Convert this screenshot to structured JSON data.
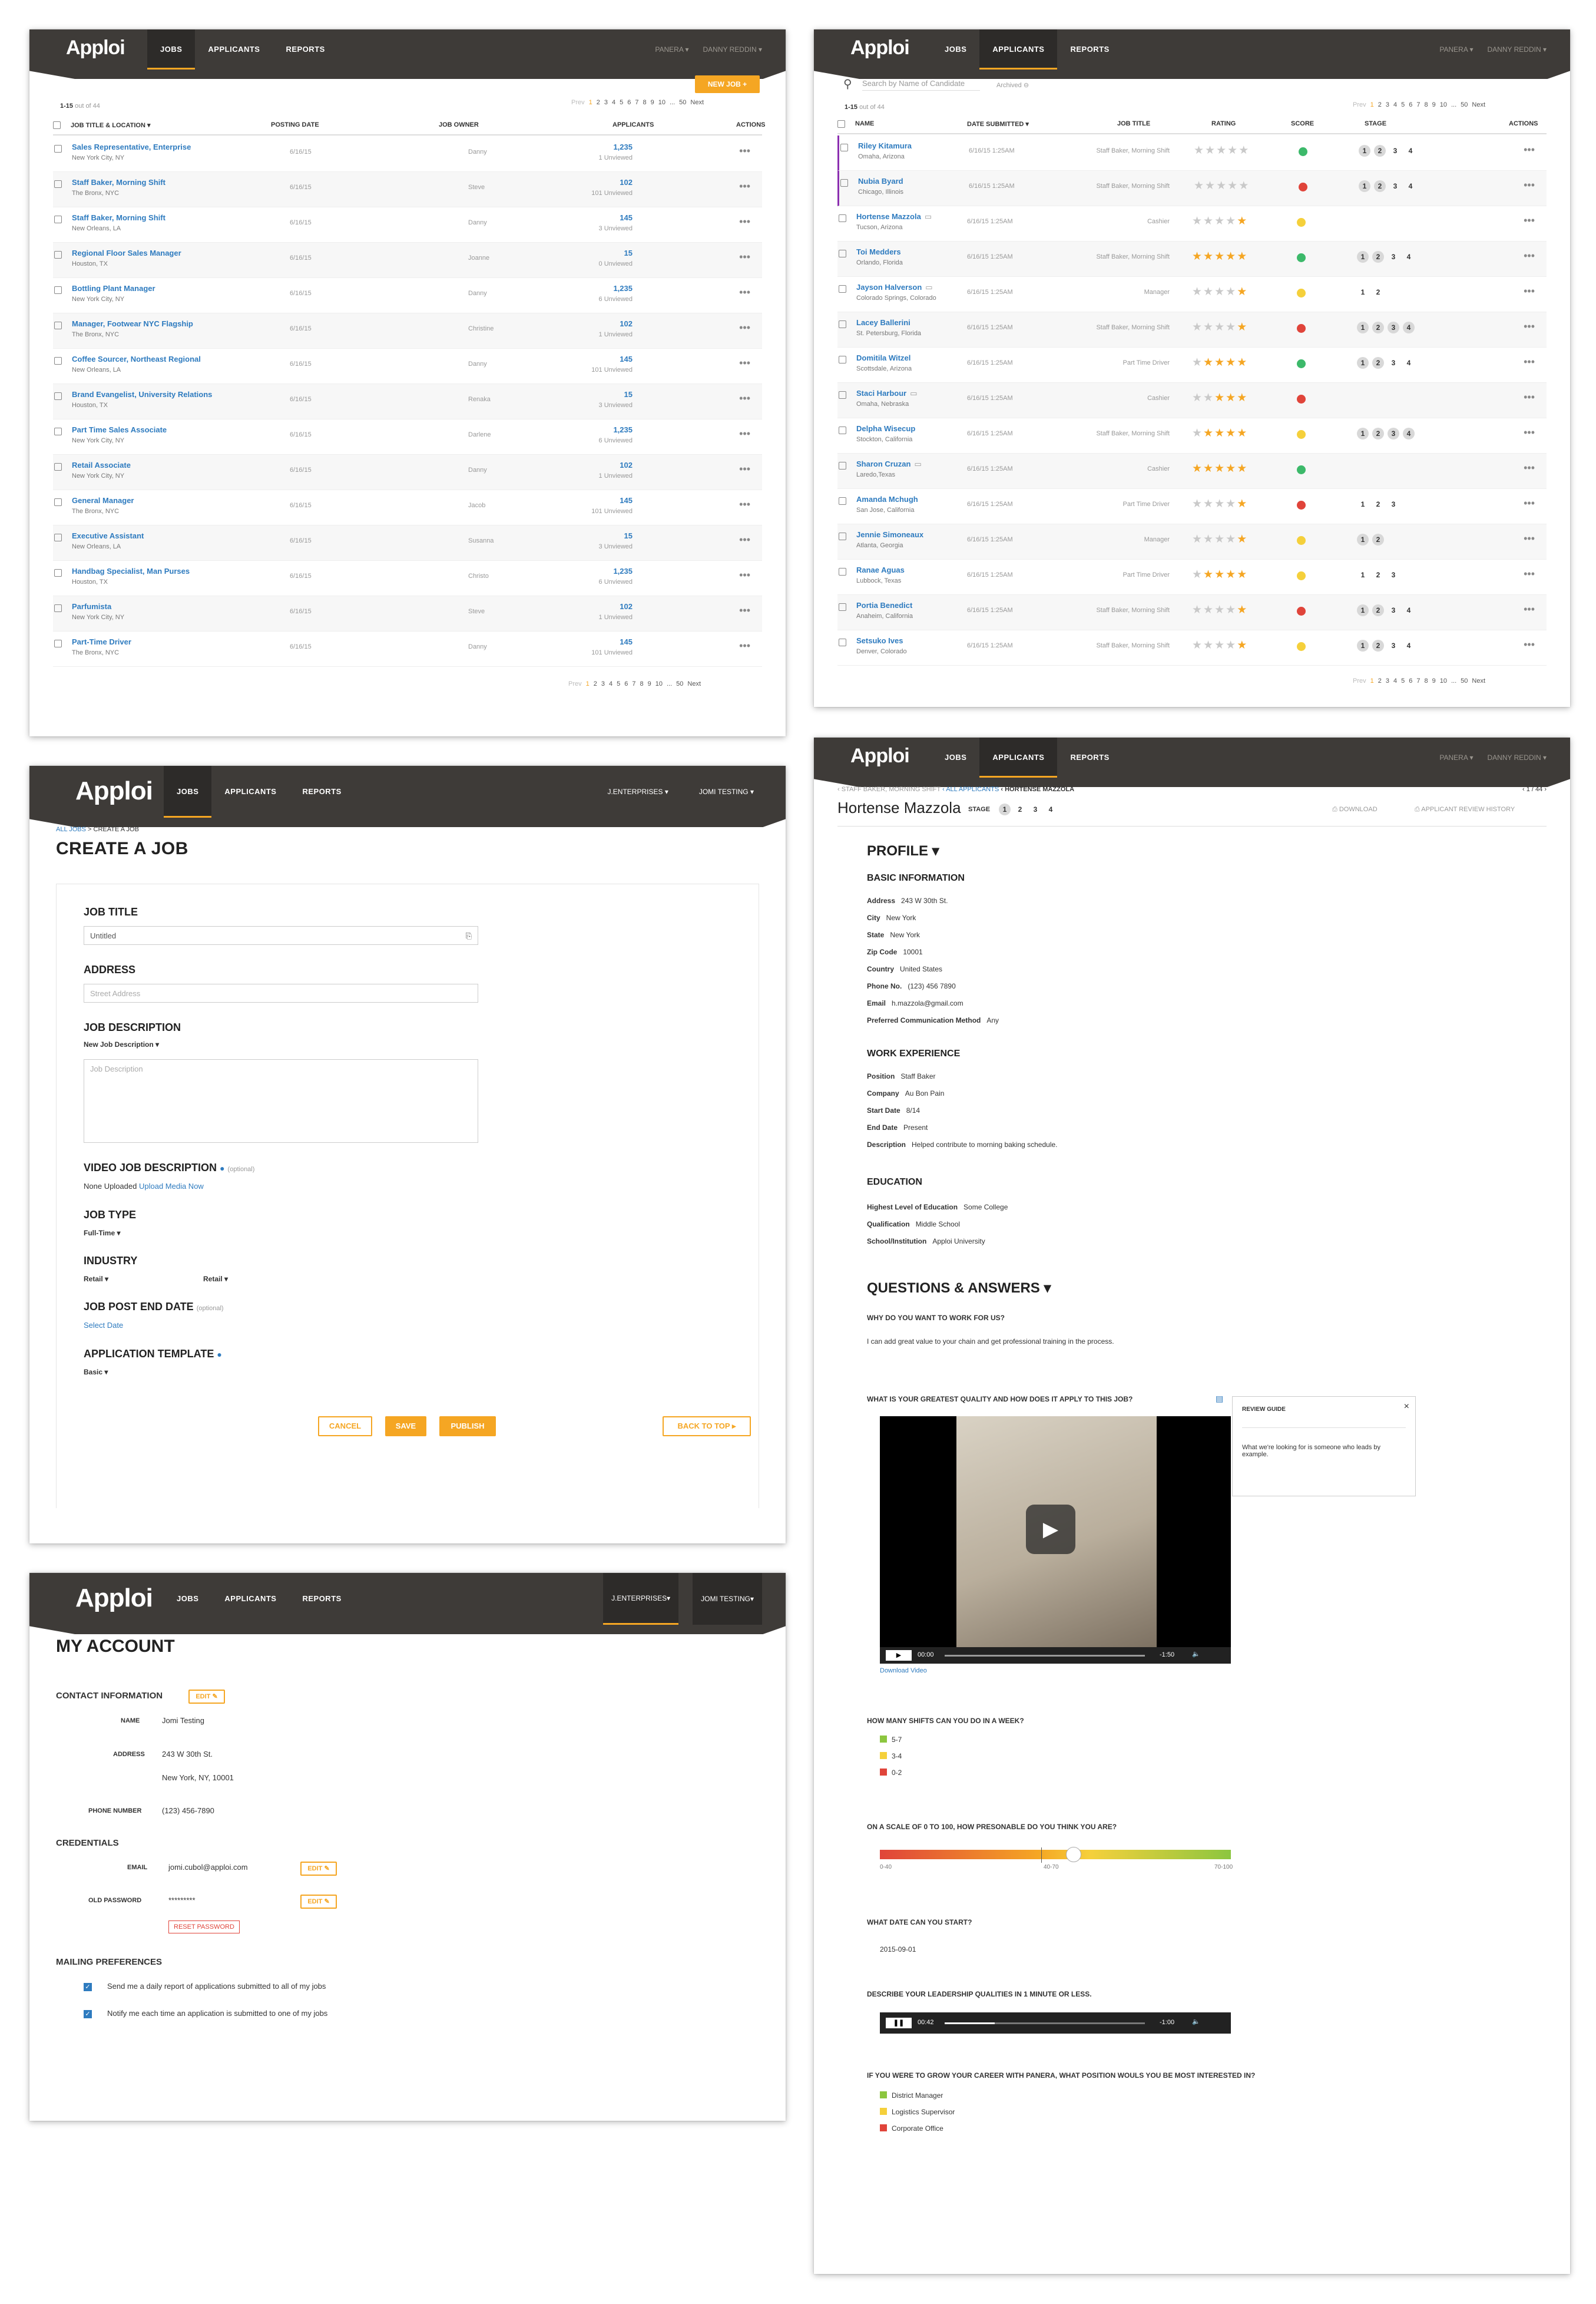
{
  "app": {
    "logo": "Apploi",
    "nav_jobs": "JOBS",
    "nav_applicants": "APPLICANTS",
    "nav_reports": "REPORTS",
    "user_company": "PANERA",
    "user_name": "DANNY REDDIN"
  },
  "jobs": {
    "new_job": "NEW JOB +",
    "range": "1-15",
    "out_of": "out of 44",
    "pagination": [
      "Prev",
      "1",
      "2",
      "3",
      "4",
      "5",
      "6",
      "7",
      "8",
      "9",
      "10",
      "...",
      "50",
      "Next"
    ],
    "columns": [
      "JOB TITLE & LOCATION",
      "POSTING DATE",
      "JOB OWNER",
      "APPLICANTS",
      "ACTIONS"
    ],
    "rows": [
      {
        "title": "Sales Representative, Enterprise",
        "loc": "New York City, NY",
        "date": "6/16/15",
        "owner": "Danny",
        "count": "1,235",
        "unviewed": "1 Unviewed"
      },
      {
        "title": "Staff Baker, Morning Shift",
        "loc": "The Bronx, NYC",
        "date": "6/16/15",
        "owner": "Steve",
        "count": "102",
        "unviewed": "101 Unviewed"
      },
      {
        "title": "Staff Baker, Morning Shift",
        "loc": "New Orleans, LA",
        "date": "6/16/15",
        "owner": "Danny",
        "count": "145",
        "unviewed": "3 Unviewed"
      },
      {
        "title": "Regional Floor Sales Manager",
        "loc": "Houston, TX",
        "date": "6/16/15",
        "owner": "Joanne",
        "count": "15",
        "unviewed": "0 Unviewed"
      },
      {
        "title": "Bottling Plant Manager",
        "loc": "New York City, NY",
        "date": "6/16/15",
        "owner": "Danny",
        "count": "1,235",
        "unviewed": "6 Unviewed"
      },
      {
        "title": "Manager, Footwear NYC Flagship",
        "loc": "The Bronx, NYC",
        "date": "6/16/15",
        "owner": "Christine",
        "count": "102",
        "unviewed": "1 Unviewed"
      },
      {
        "title": "Coffee Sourcer, Northeast Regional",
        "loc": "New Orleans, LA",
        "date": "6/16/15",
        "owner": "Danny",
        "count": "145",
        "unviewed": "101 Unviewed"
      },
      {
        "title": "Brand Evangelist, University Relations",
        "loc": "Houston, TX",
        "date": "6/16/15",
        "owner": "Renaka",
        "count": "15",
        "unviewed": "3 Unviewed"
      },
      {
        "title": "Part Time Sales Associate",
        "loc": "New York City, NY",
        "date": "6/16/15",
        "owner": "Darlene",
        "count": "1,235",
        "unviewed": "6 Unviewed"
      },
      {
        "title": "Retail Associate",
        "loc": "New York City, NY",
        "date": "6/16/15",
        "owner": "Danny",
        "count": "102",
        "unviewed": "1 Unviewed"
      },
      {
        "title": "General Manager",
        "loc": "The Bronx, NYC",
        "date": "6/16/15",
        "owner": "Jacob",
        "count": "145",
        "unviewed": "101 Unviewed"
      },
      {
        "title": "Executive Assistant",
        "loc": "New Orleans, LA",
        "date": "6/16/15",
        "owner": "Susanna",
        "count": "15",
        "unviewed": "3 Unviewed"
      },
      {
        "title": "Handbag Specialist, Man Purses",
        "loc": "Houston, TX",
        "date": "6/16/15",
        "owner": "Christo",
        "count": "1,235",
        "unviewed": "6 Unviewed"
      },
      {
        "title": "Parfumista",
        "loc": "New York City, NY",
        "date": "6/16/15",
        "owner": "Steve",
        "count": "102",
        "unviewed": "1 Unviewed"
      },
      {
        "title": "Part-Time Driver",
        "loc": "The Bronx, NYC",
        "date": "6/16/15",
        "owner": "Danny",
        "count": "145",
        "unviewed": "101 Unviewed"
      }
    ]
  },
  "applicants": {
    "search_placeholder": "Search by Name of Candidate",
    "archived": "Archived",
    "range": "1-15",
    "out_of": "out of 44",
    "pagination": [
      "Prev",
      "1",
      "2",
      "3",
      "4",
      "5",
      "6",
      "7",
      "8",
      "9",
      "10",
      "...",
      "50",
      "Next"
    ],
    "columns": [
      "NAME",
      "DATE SUBMITTED",
      "JOB TITLE",
      "RATING",
      "SCORE",
      "STAGE",
      "ACTIONS"
    ],
    "rows": [
      {
        "name": "Riley Kitamura",
        "loc": "Omaha, Arizona",
        "date": "6/16/15 1:25AM",
        "job": "Staff Baker, Morning Shift",
        "rating": 0,
        "score": "#3cb96a",
        "stage": [
          "1",
          "2",
          "3",
          "4"
        ],
        "filled": 2
      },
      {
        "name": "Nubia Byard",
        "loc": "Chicago, Illinois",
        "date": "6/16/15 1:25AM",
        "job": "Staff Baker, Morning Shift",
        "rating": 0,
        "score": "#e0443a",
        "stage": [
          "1",
          "2",
          "3",
          "4"
        ],
        "filled": 2
      },
      {
        "name": "Hortense Mazzola",
        "loc": "Tucson, Arizona",
        "date": "6/16/15 1:25AM",
        "job": "Cashier",
        "rating": 1,
        "score": "#f5d03b",
        "stage": [],
        "filled": 0
      },
      {
        "name": "Toi Medders",
        "loc": "Orlando, Florida",
        "date": "6/16/15 1:25AM",
        "job": "Staff Baker, Morning Shift",
        "rating": 5,
        "score": "#3cb96a",
        "stage": [
          "1",
          "2",
          "3",
          "4"
        ],
        "filled": 2
      },
      {
        "name": "Jayson Halverson",
        "loc": "Colorado Springs, Colorado",
        "date": "6/16/15 1:25AM",
        "job": "Manager",
        "rating": 1,
        "score": "#f5d03b",
        "stage": [
          "1",
          "2"
        ],
        "filled": 0
      },
      {
        "name": "Lacey Ballerini",
        "loc": "St. Petersburg, Florida",
        "date": "6/16/15 1:25AM",
        "job": "Staff Baker, Morning Shift",
        "rating": 1,
        "score": "#e0443a",
        "stage": [
          "1",
          "2",
          "3",
          "4"
        ],
        "filled": 4
      },
      {
        "name": "Domitila Witzel",
        "loc": "Scottsdale, Arizona",
        "date": "6/16/15 1:25AM",
        "job": "Part Time Driver",
        "rating": 4,
        "score": "#3cb96a",
        "stage": [
          "1",
          "2",
          "3",
          "4"
        ],
        "filled": 2
      },
      {
        "name": "Staci Harbour",
        "loc": "Omaha, Nebraska",
        "date": "6/16/15 1:25AM",
        "job": "Cashier",
        "rating": 3,
        "score": "#e0443a",
        "stage": [],
        "filled": 0
      },
      {
        "name": "Delpha Wisecup",
        "loc": "Stockton, California",
        "date": "6/16/15 1:25AM",
        "job": "Staff Baker, Morning Shift",
        "rating": 4,
        "score": "#f5d03b",
        "stage": [
          "1",
          "2",
          "3",
          "4"
        ],
        "filled": 4
      },
      {
        "name": "Sharon Cruzan",
        "loc": "Laredo,Texas",
        "date": "6/16/15 1:25AM",
        "job": "Cashier",
        "rating": 5,
        "score": "#3cb96a",
        "stage": [],
        "filled": 0
      },
      {
        "name": "Amanda Mchugh",
        "loc": "San Jose, California",
        "date": "6/16/15 1:25AM",
        "job": "Part Time Driver",
        "rating": 1,
        "score": "#e0443a",
        "stage": [
          "1",
          "2",
          "3"
        ],
        "filled": 0
      },
      {
        "name": "Jennie Simoneaux",
        "loc": "Atlanta, Georgia",
        "date": "6/16/15 1:25AM",
        "job": "Manager",
        "rating": 1,
        "score": "#f5d03b",
        "stage": [
          "1",
          "2"
        ],
        "filled": 2
      },
      {
        "name": "Ranae Aguas",
        "loc": "Lubbock, Texas",
        "date": "6/16/15 1:25AM",
        "job": "Part Time Driver",
        "rating": 4,
        "score": "#f5d03b",
        "stage": [
          "1",
          "2",
          "3"
        ],
        "filled": 0
      },
      {
        "name": "Portia Benedict",
        "loc": "Anaheim, California",
        "date": "6/16/15 1:25AM",
        "job": "Staff Baker, Morning Shift",
        "rating": 1,
        "score": "#e0443a",
        "stage": [
          "1",
          "2",
          "3",
          "4"
        ],
        "filled": 2
      },
      {
        "name": "Setsuko Ives",
        "loc": "Denver, Colorado",
        "date": "6/16/15 1:25AM",
        "job": "Staff Baker, Morning Shift",
        "rating": 1,
        "score": "#f5d03b",
        "stage": [
          "1",
          "2",
          "3",
          "4"
        ],
        "filled": 2
      }
    ]
  },
  "create": {
    "org": "J.ENTERPRISES",
    "user": "JOMI TESTING",
    "crumb_all": "ALL JOBS",
    "crumb_sep": ">",
    "crumb_cur": "CREATE A JOB",
    "title": "CREATE A JOB",
    "job_title_label": "JOB TITLE",
    "job_title_value": "Untitled",
    "address_label": "ADDRESS",
    "address_placeholder": "Street Address",
    "desc_label": "JOB DESCRIPTION",
    "desc_select": "New Job Description",
    "desc_placeholder": "Job Description",
    "video_label": "VIDEO JOB DESCRIPTION",
    "video_optional": "(optional)",
    "video_none": "None Uploaded",
    "video_upload": "Upload Media Now",
    "type_label": "JOB TYPE",
    "type_value": "Full-Time",
    "industry_label": "INDUSTRY",
    "industry_value1": "Retail",
    "industry_value2": "Retail",
    "end_label": "JOB POST END DATE",
    "end_optional": "(optional)",
    "end_value": "Select Date",
    "template_label": "APPLICATION TEMPLATE",
    "template_value": "Basic",
    "cancel": "CANCEL",
    "save": "SAVE",
    "publish": "PUBLISH",
    "back": "BACK TO TOP"
  },
  "account": {
    "org": "J.ENTERPRISES",
    "user": "JOMI TESTING",
    "title": "MY ACCOUNT",
    "contact_title": "CONTACT INFORMATION",
    "edit": "EDIT",
    "name_label": "NAME",
    "name": "Jomi Testing",
    "address_label": "ADDRESS",
    "address1": "243 W 30th St.",
    "address2": "New York, NY, 10001",
    "phone_label": "PHONE NUMBER",
    "phone": "(123) 456-7890",
    "cred_title": "CREDENTIALS",
    "email_label": "EMAIL",
    "email": "jomi.cubol@apploi.com",
    "pw_label": "OLD PASSWORD",
    "pw": "*********",
    "reset": "RESET PASSWORD",
    "mail_title": "MAILING PREFERENCES",
    "pref1": "Send me a daily report of applications submitted to all of my jobs",
    "pref2": "Notify me each time an application is submitted to one of my jobs"
  },
  "profile": {
    "crumb1": "STAFF BAKER, MORNING SHIFT",
    "crumb2": "ALL APPLICANTS",
    "crumb3": "HORTENSE MAZZOLA",
    "counter": "1 / 44",
    "name": "Hortense Mazzola",
    "stage_label": "STAGE",
    "stages": [
      "1",
      "2",
      "3",
      "4"
    ],
    "download": "DOWNLOAD",
    "history": "APPLICANT REVIEW HISTORY",
    "profile_title": "PROFILE",
    "basic_title": "BASIC INFORMATION",
    "basic": [
      [
        "Address",
        "243 W 30th St."
      ],
      [
        "City",
        "New York"
      ],
      [
        "State",
        "New York"
      ],
      [
        "Zip Code",
        "10001"
      ],
      [
        "Country",
        "United States"
      ],
      [
        "Phone No.",
        "(123) 456 7890"
      ],
      [
        "Email",
        "h.mazzola@gmail.com"
      ],
      [
        "Preferred Communication Method",
        "Any"
      ]
    ],
    "work_title": "WORK EXPERIENCE",
    "work": [
      [
        "Position",
        "Staff Baker"
      ],
      [
        "Company",
        "Au Bon Pain"
      ],
      [
        "Start Date",
        "8/14"
      ],
      [
        "End Date",
        "Present"
      ],
      [
        "Description",
        "Helped contribute to morning baking schedule."
      ]
    ],
    "edu_title": "EDUCATION",
    "edu": [
      [
        "Highest Level of Education",
        "Some College"
      ],
      [
        "Qualification",
        "Middle School"
      ],
      [
        "School/Institution",
        "Apploi University"
      ]
    ],
    "qa_title": "QUESTIONS & ANSWERS",
    "q1": "WHY DO YOU WANT TO WORK FOR US?",
    "a1": "I can add great value to your chain and get professional training in the process.",
    "q2": "WHAT IS YOUR GREATEST QUALITY AND HOW DOES IT APPLY TO THIS JOB?",
    "guide_title": "REVIEW GUIDE",
    "guide_text": "What we're looking for is someone who leads by example.",
    "video_time": "00:00",
    "video_remaining": "-1:50",
    "download_video": "Download Video",
    "q3": "HOW MANY SHIFTS CAN YOU DO IN A WEEK?",
    "shift_options": [
      [
        "5-7",
        "#8cc63f"
      ],
      [
        "3-4",
        "#f5d03b"
      ],
      [
        "0-2",
        "#e0443a"
      ]
    ],
    "q4": "ON A SCALE OF 0 TO 100, HOW PRESONABLE DO YOU THINK YOU ARE?",
    "scale_labels": [
      "0-40",
      "40-70",
      "70-100"
    ],
    "scale_value": 0.55,
    "q5": "WHAT DATE CAN YOU START?",
    "a5": "2015-09-01",
    "q6": "DESCRIBE YOUR LEADERSHIP QUALITIES IN 1 MINUTE OR LESS.",
    "audio_time": "00:42",
    "audio_remaining": "-1:00",
    "q7": "IF YOU WERE TO GROW YOUR CAREER WITH PANERA, WHAT POSITION WOULS YOU BE MOST INTERESTED IN?",
    "career_options": [
      [
        "District Manager",
        "#8cc63f"
      ],
      [
        "Logistics Supervisor",
        "#f5d03b"
      ],
      [
        "Corporate Office",
        "#e0443a"
      ]
    ]
  }
}
